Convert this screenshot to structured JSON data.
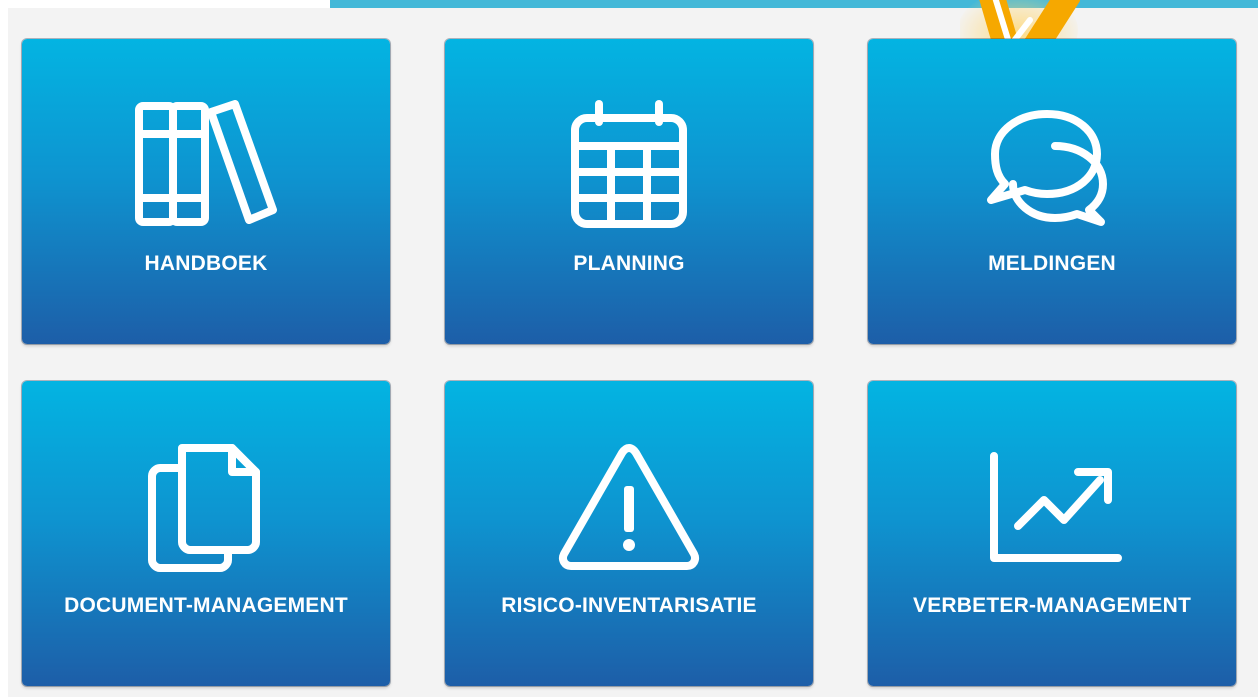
{
  "colors": {
    "background": "#f3f3f3",
    "topbar_accent": "#43b8d8",
    "tile_gradient_top": "#03b4e2",
    "tile_gradient_bottom": "#1d5ea8",
    "label": "#ffffff",
    "badge": "#f6a800"
  },
  "tiles": [
    {
      "label": "HANDBOEK",
      "icon": "books-icon"
    },
    {
      "label": "PLANNING",
      "icon": "calendar-icon"
    },
    {
      "label": "MELDINGEN",
      "icon": "chat-bubbles-icon"
    },
    {
      "label": "DOCUMENT-MANAGEMENT",
      "icon": "documents-icon"
    },
    {
      "label": "RISICO-INVENTARISATIE",
      "icon": "warning-icon"
    },
    {
      "label": "VERBETER-MANAGEMENT",
      "icon": "trend-chart-icon"
    }
  ]
}
